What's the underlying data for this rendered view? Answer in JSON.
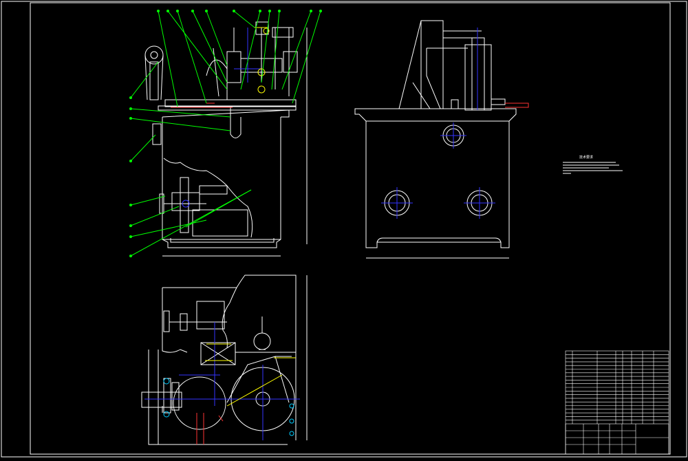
{
  "drawing": {
    "background": "#000000",
    "colors": {
      "outline": "#ffffff",
      "leader": "#00ff00",
      "centerline": "#3333ff",
      "accent": "#ffff00",
      "hidden": "#ff66ff",
      "section": "#ff3333",
      "fastener": "#00ccff"
    },
    "views": [
      {
        "name": "front-view",
        "label": ""
      },
      {
        "name": "side-view",
        "label": ""
      },
      {
        "name": "top-view",
        "label": ""
      }
    ],
    "technical_notes": {
      "heading": "技术要求",
      "lines": []
    },
    "title_block": {
      "title": "",
      "parts_rows": 20
    }
  }
}
